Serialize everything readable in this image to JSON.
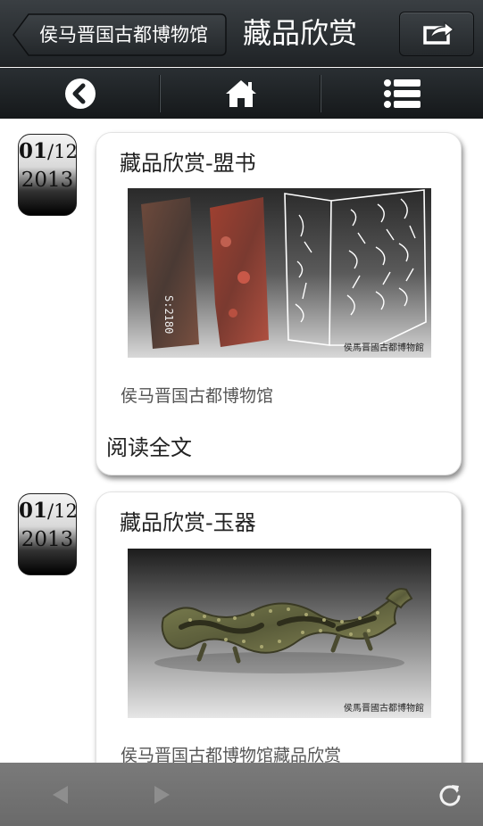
{
  "header": {
    "back_label": "侯马晋国古都博物馆",
    "title": "藏品欣赏",
    "share_icon": "share-icon"
  },
  "navbar": {
    "items": [
      {
        "icon": "back-circle-icon"
      },
      {
        "icon": "home-icon"
      },
      {
        "icon": "list-menu-icon"
      }
    ]
  },
  "articles": [
    {
      "date_day": "01",
      "date_month": "/12",
      "date_year": "2013",
      "title": "藏品欣赏-盟书",
      "image_stamp": "侯馬晋國古都博物館",
      "image_tag": "S:2180",
      "description": "侯马晋国古都博物馆",
      "read_more": "阅读全文"
    },
    {
      "date_day": "01",
      "date_month": "/12",
      "date_year": "2013",
      "title": "藏品欣赏-玉器",
      "image_stamp": "侯馬晋國古都博物館",
      "description": "侯马晋国古都博物馆藏品欣赏"
    }
  ],
  "toolbar": {
    "items": [
      {
        "icon": "browser-back-icon"
      },
      {
        "icon": "browser-forward-icon"
      },
      {
        "icon": "refresh-icon"
      }
    ]
  },
  "colors": {
    "header_dark": "#1f2326",
    "toolbar_gray": "#727272",
    "card_border": "#e2e2e2"
  }
}
